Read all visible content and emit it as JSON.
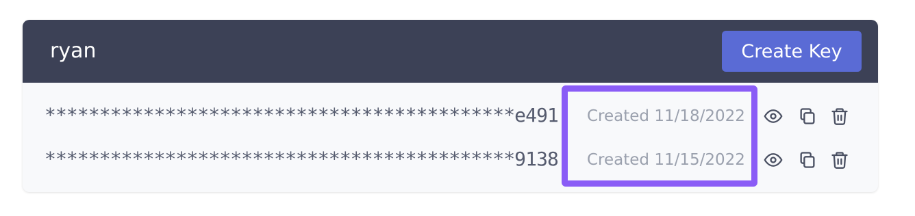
{
  "header": {
    "user_name": "ryan",
    "create_button_label": "Create Key"
  },
  "keys": [
    {
      "masked_value": "*******************************************e491",
      "created_label": "Created 11/18/2022"
    },
    {
      "masked_value": "*******************************************9138",
      "created_label": "Created 11/15/2022"
    }
  ],
  "icons": {
    "reveal": "eye-icon",
    "copy": "copy-icon",
    "delete": "trash-icon"
  },
  "colors": {
    "header_bg": "#3c4156",
    "accent_button": "#5a6bd5",
    "highlight": "#8a5cf6",
    "card_bg": "#f8f9fb"
  }
}
